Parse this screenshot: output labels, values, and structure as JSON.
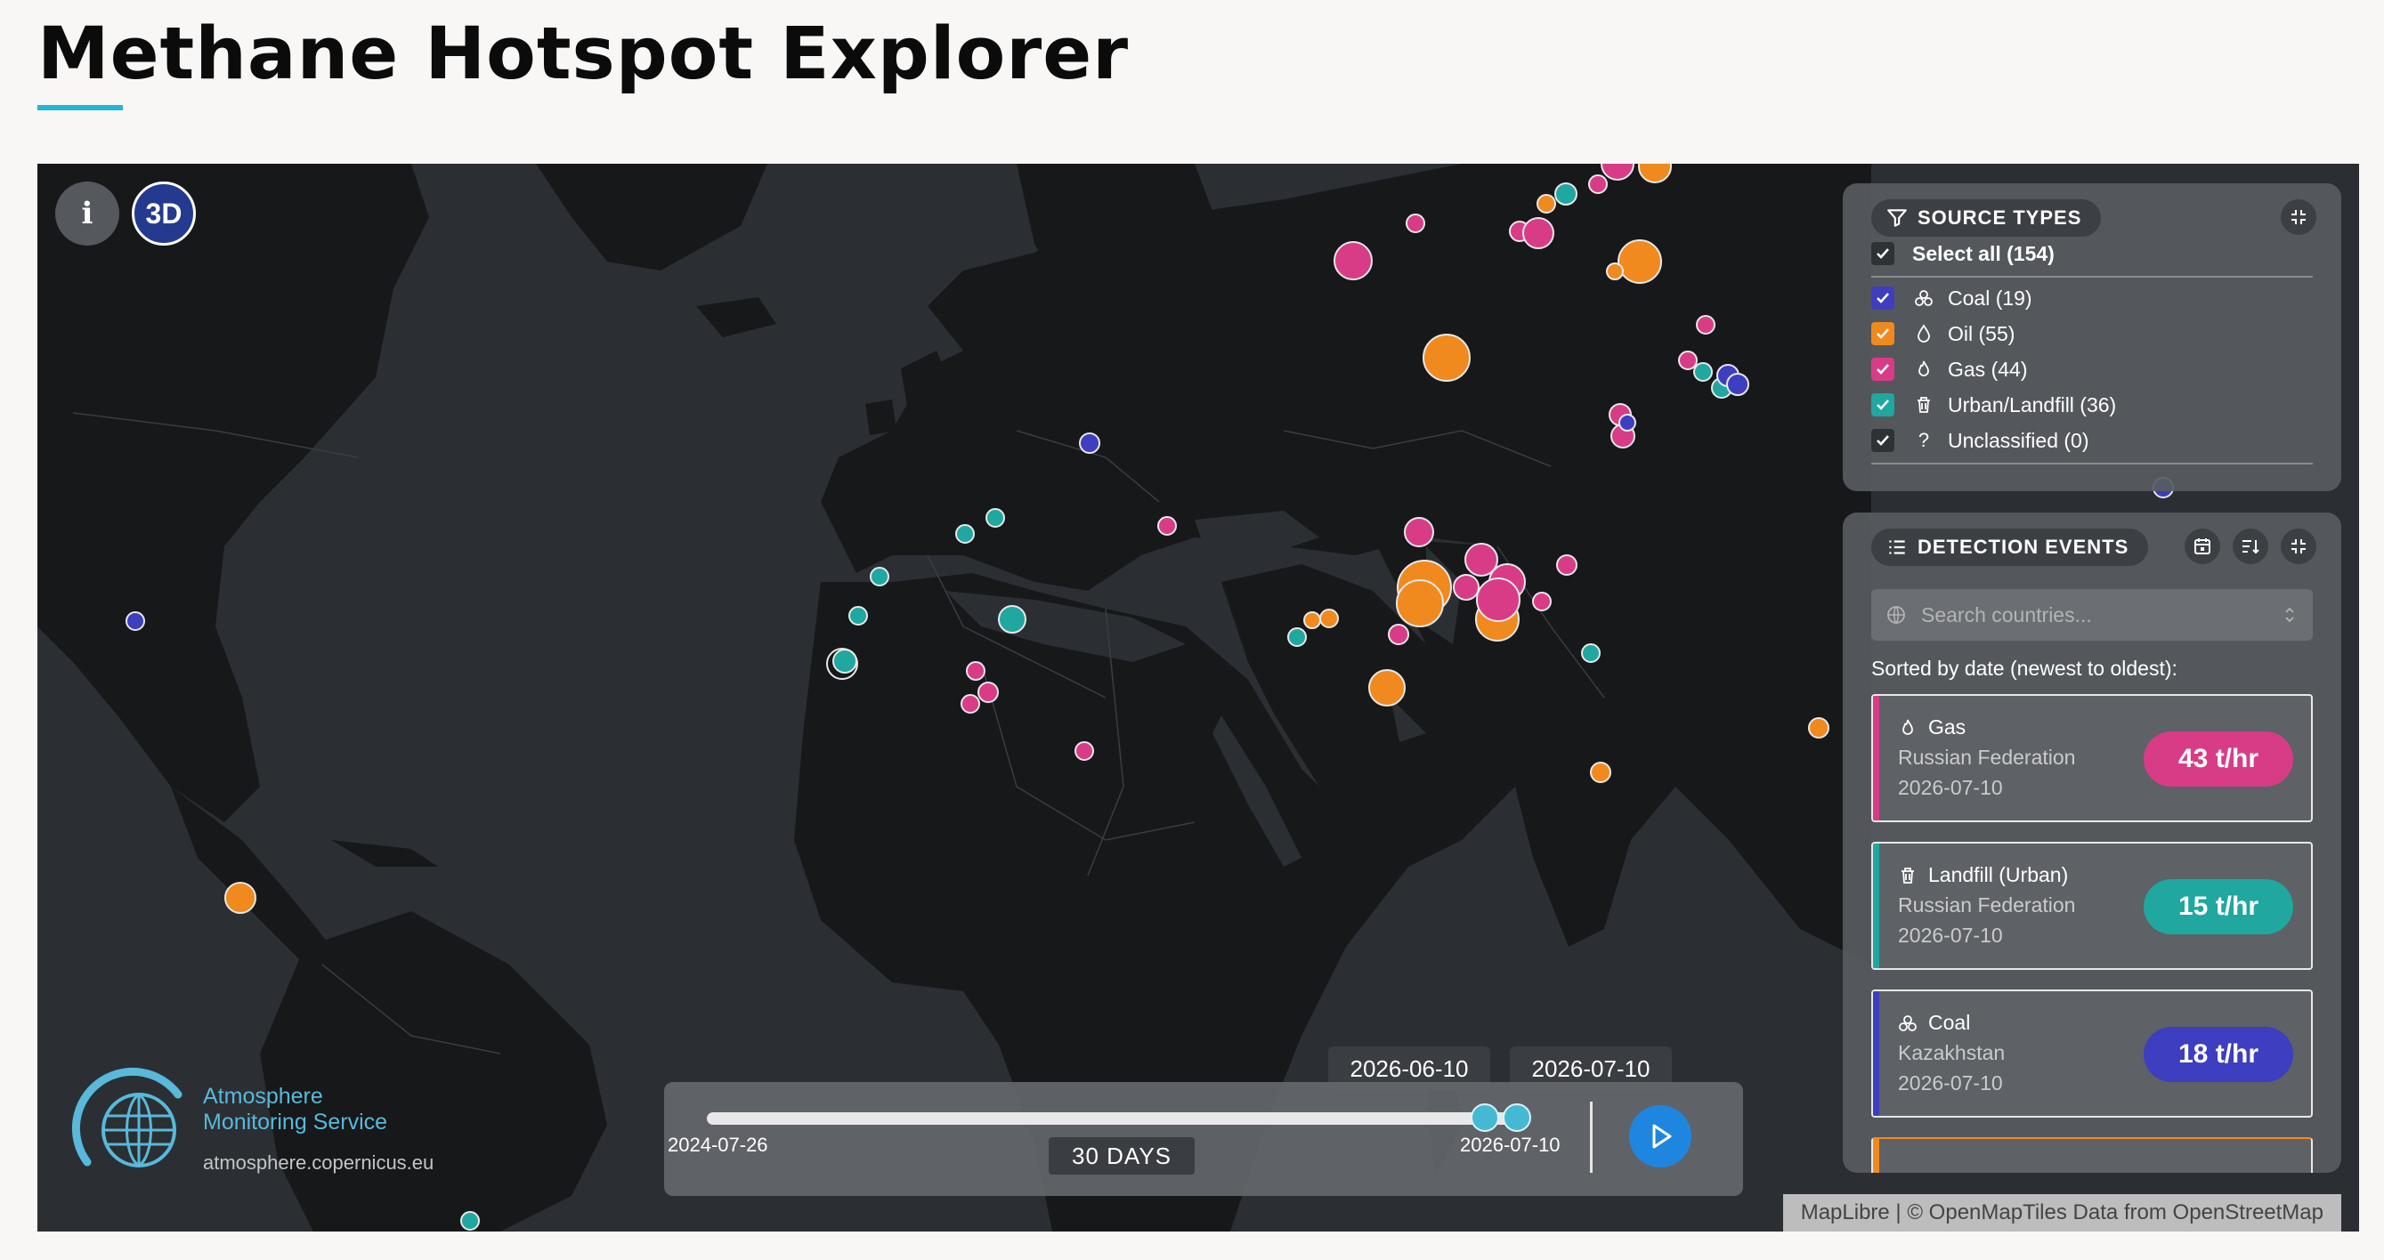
{
  "page": {
    "title": "Methane Hotspot Explorer"
  },
  "map_buttons": {
    "info_label": "i",
    "view_3d_label": "3D"
  },
  "colors": {
    "coal": "#3d3ec0",
    "oil": "#f08a1e",
    "gas": "#d83c86",
    "urban_landfill": "#1fa7a0",
    "accent": "#22b5d6",
    "play": "#1f86e0"
  },
  "source_types": {
    "title": "SOURCE TYPES",
    "select_all": "Select all (154)",
    "items": [
      {
        "label": "Coal (19)",
        "color": "#3d3ec0",
        "icon": "coal-icon"
      },
      {
        "label": "Oil (55)",
        "color": "#f08a1e",
        "icon": "oil-drop-icon"
      },
      {
        "label": "Gas (44)",
        "color": "#d83c86",
        "icon": "flame-icon"
      },
      {
        "label": "Urban/Landfill (36)",
        "color": "#1fa7a0",
        "icon": "trash-icon"
      },
      {
        "label": "Unclassified (0)",
        "color": "#3c3f43",
        "icon": "question-icon"
      }
    ]
  },
  "detection_events": {
    "title": "DETECTION EVENTS",
    "search_placeholder": "Search countries...",
    "sorted_label": "Sorted by date (newest to oldest):",
    "events": [
      {
        "type": "Gas",
        "country": "Russian Federation",
        "date": "2026-07-10",
        "rate": "43 t/hr",
        "color": "#d83c86",
        "icon": "flame-icon"
      },
      {
        "type": "Landfill (Urban)",
        "country": "Russian Federation",
        "date": "2026-07-10",
        "rate": "15 t/hr",
        "color": "#1fa7a0",
        "icon": "trash-icon"
      },
      {
        "type": "Coal",
        "country": "Kazakhstan",
        "date": "2026-07-10",
        "rate": "18 t/hr",
        "color": "#3d3ec0",
        "icon": "coal-icon"
      }
    ]
  },
  "timeline": {
    "start_label": "2024-07-26",
    "end_label": "2026-07-10",
    "window_label": "30 DAYS",
    "tooltip_start": "2026-06-10",
    "tooltip_end": "2026-07-10"
  },
  "branding": {
    "name_line1": "Atmosphere",
    "name_line2": "Monitoring Service",
    "url": "atmosphere.copernicus.eu"
  },
  "attribution": "MapLibre | © OpenMapTiles Data from OpenStreetMap"
}
